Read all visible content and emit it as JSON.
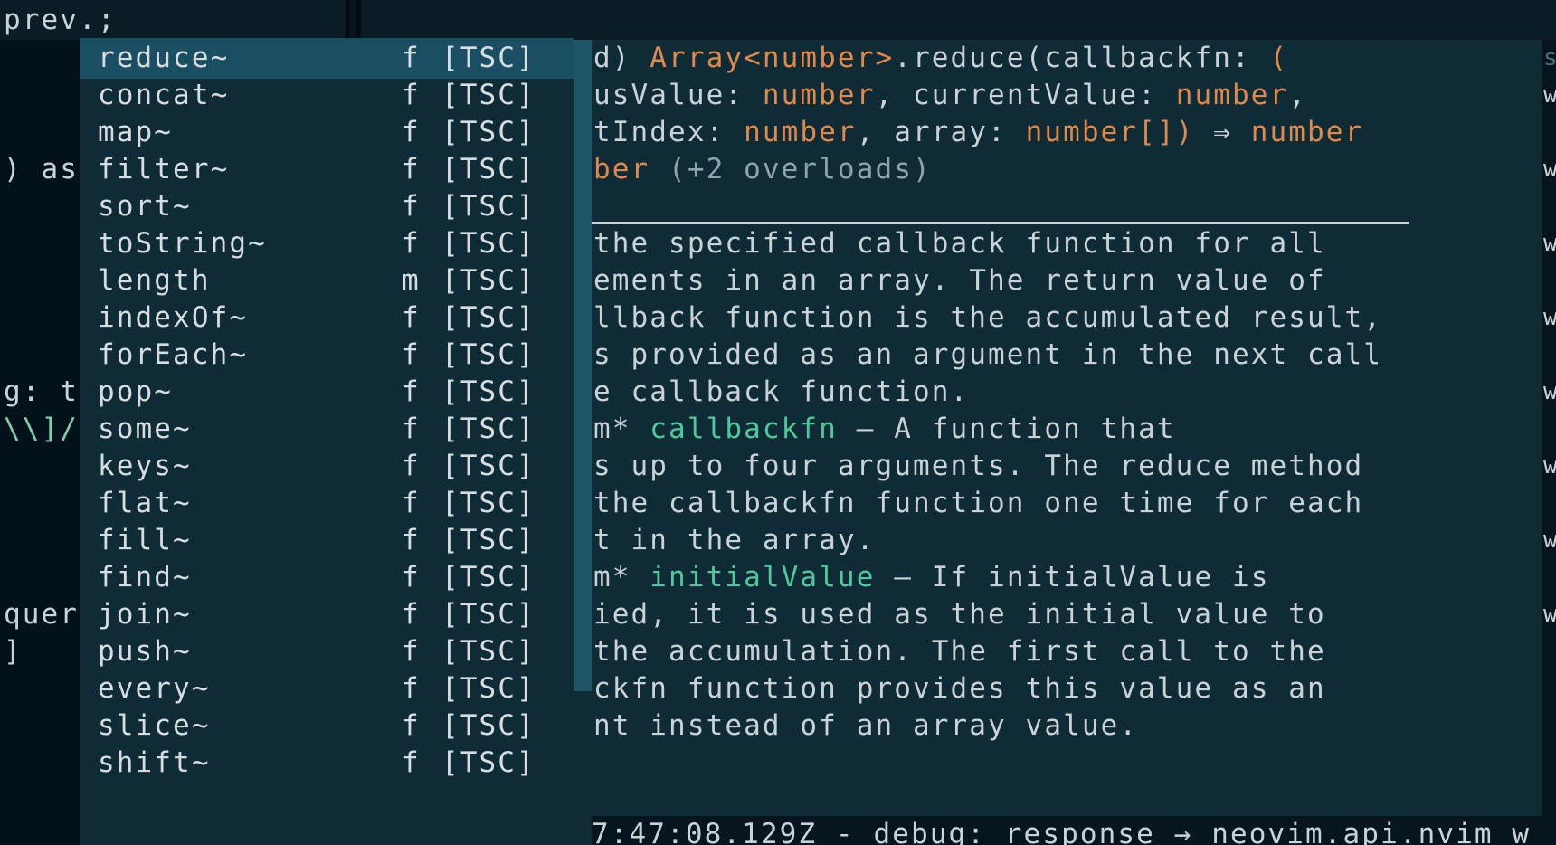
{
  "editor": {
    "top_line": "prev.;",
    "left_buffer": [
      {
        "row": 3,
        "text": ") as",
        "green": false
      },
      {
        "row": 9,
        "text": "g: t",
        "green": false
      },
      {
        "row": 10,
        "text": "\\\\]/",
        "green": true
      },
      {
        "row": 15,
        "text": "quer",
        "green": false
      },
      {
        "row": 16,
        "text": "]",
        "green": false
      }
    ]
  },
  "completion_menu": {
    "selected_index": 0,
    "items": [
      {
        "word": "reduce~",
        "kind": "f",
        "source": "[TSC]"
      },
      {
        "word": "concat~",
        "kind": "f",
        "source": "[TSC]"
      },
      {
        "word": "map~",
        "kind": "f",
        "source": "[TSC]"
      },
      {
        "word": "filter~",
        "kind": "f",
        "source": "[TSC]"
      },
      {
        "word": "sort~",
        "kind": "f",
        "source": "[TSC]"
      },
      {
        "word": "toString~",
        "kind": "f",
        "source": "[TSC]"
      },
      {
        "word": "length",
        "kind": "m",
        "source": "[TSC]"
      },
      {
        "word": "indexOf~",
        "kind": "f",
        "source": "[TSC]"
      },
      {
        "word": "forEach~",
        "kind": "f",
        "source": "[TSC]"
      },
      {
        "word": "pop~",
        "kind": "f",
        "source": "[TSC]"
      },
      {
        "word": "some~",
        "kind": "f",
        "source": "[TSC]"
      },
      {
        "word": "keys~",
        "kind": "f",
        "source": "[TSC]"
      },
      {
        "word": "flat~",
        "kind": "f",
        "source": "[TSC]"
      },
      {
        "word": "fill~",
        "kind": "f",
        "source": "[TSC]"
      },
      {
        "word": "find~",
        "kind": "f",
        "source": "[TSC]"
      },
      {
        "word": "join~",
        "kind": "f",
        "source": "[TSC]"
      },
      {
        "word": "push~",
        "kind": "f",
        "source": "[TSC]"
      },
      {
        "word": "every~",
        "kind": "f",
        "source": "[TSC]"
      },
      {
        "word": "slice~",
        "kind": "f",
        "source": "[TSC]"
      },
      {
        "word": "shift~",
        "kind": "f",
        "source": "[TSC]"
      }
    ]
  },
  "documentation": {
    "signature": [
      [
        {
          "t": "d) "
        },
        {
          "t": "Array<number>",
          "c": "type"
        },
        {
          "t": ".reduce(callbackfn: "
        },
        {
          "t": "(",
          "c": "punct"
        }
      ],
      [
        {
          "t": "usValue: "
        },
        {
          "t": "number",
          "c": "type"
        },
        {
          "t": ", currentValue: "
        },
        {
          "t": "number",
          "c": "type"
        },
        {
          "t": ","
        }
      ],
      [
        {
          "t": "tIndex: "
        },
        {
          "t": "number",
          "c": "type"
        },
        {
          "t": ", array: "
        },
        {
          "t": "number[])",
          "c": "type"
        },
        {
          "t": " ⇒ "
        },
        {
          "t": "number",
          "c": "type"
        }
      ],
      [
        {
          "t": "ber",
          "c": "type"
        },
        {
          "t": " (+2 overloads)",
          "c": "dim"
        }
      ]
    ],
    "body": [
      [
        {
          "t": "the specified callback function for all"
        }
      ],
      [
        {
          "t": "ements in an array. The return value of"
        }
      ],
      [
        {
          "t": "llback function is the accumulated result,"
        }
      ],
      [
        {
          "t": "s provided as an argument in the next call"
        }
      ],
      [
        {
          "t": "e callback function."
        }
      ],
      [
        {
          "t": "m* "
        },
        {
          "t": "callbackfn",
          "c": "param"
        },
        {
          "t": " — A function that"
        }
      ],
      [
        {
          "t": "s up to four arguments. The reduce method"
        }
      ],
      [
        {
          "t": "the callbackfn function one time for each"
        }
      ],
      [
        {
          "t": "t in the array."
        }
      ],
      [
        {
          "t": "m* "
        },
        {
          "t": "initialValue",
          "c": "param"
        },
        {
          "t": " — If initialValue is"
        }
      ],
      [
        {
          "t": "ied, it is used as the initial value to"
        }
      ],
      [
        {
          "t": "the accumulation. The first call to the"
        }
      ],
      [
        {
          "t": "ckfn function provides this value as an"
        }
      ],
      [
        {
          "t": "nt instead of an array value."
        }
      ]
    ]
  },
  "log_line": "7:47:08.129Z - debug: response → neovim.api.nvim_w",
  "right_column": [
    {
      "row": 0,
      "text": "s",
      "dim": true
    },
    {
      "row": 1,
      "text": "w",
      "dim": false
    },
    {
      "row": 3,
      "text": "w",
      "dim": false
    },
    {
      "row": 5,
      "text": "w",
      "dim": false
    },
    {
      "row": 7,
      "text": "w",
      "dim": false
    },
    {
      "row": 9,
      "text": "w",
      "dim": false
    },
    {
      "row": 11,
      "text": "w",
      "dim": false
    },
    {
      "row": 13,
      "text": "w",
      "dim": false
    },
    {
      "row": 15,
      "text": "w",
      "dim": false
    }
  ]
}
